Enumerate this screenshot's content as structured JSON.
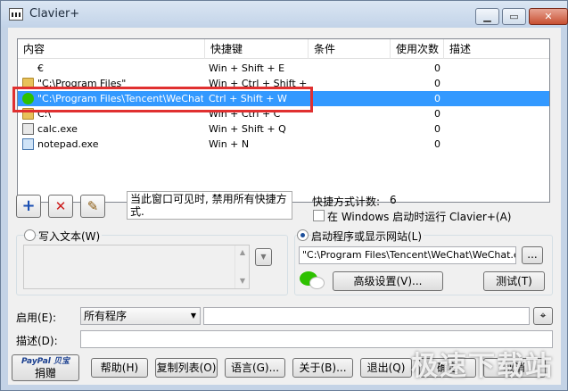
{
  "window": {
    "title": "Clavier+",
    "controls": {
      "minimize": "▁",
      "maximize": "▭",
      "close": "✕"
    }
  },
  "list": {
    "columns": [
      "内容",
      "快捷键",
      "条件",
      "使用次数",
      "描述"
    ],
    "rows": [
      {
        "content": "€",
        "hotkey": "Win + Shift + E",
        "condition": "",
        "uses": "0",
        "description": "",
        "icon": "blank-icon"
      },
      {
        "content": "\"C:\\Program Files\"",
        "hotkey": "Win + Ctrl + Shift + P",
        "condition": "",
        "uses": "0",
        "description": "",
        "icon": "folder-icon"
      },
      {
        "content": "\"C:\\Program Files\\Tencent\\WeChat\\...",
        "hotkey": "Ctrl + Shift + W",
        "condition": "",
        "uses": "0",
        "description": "",
        "icon": "wechat-icon",
        "selected": true
      },
      {
        "content": "C:\\",
        "hotkey": "Win + Ctrl + C",
        "condition": "",
        "uses": "0",
        "description": "",
        "icon": "folder-icon"
      },
      {
        "content": "calc.exe",
        "hotkey": "Win + Shift + Q",
        "condition": "",
        "uses": "0",
        "description": "",
        "icon": "calculator-icon"
      },
      {
        "content": "notepad.exe",
        "hotkey": "Win + N",
        "condition": "",
        "uses": "0",
        "description": "",
        "icon": "notepad-icon"
      }
    ]
  },
  "toolbar": {
    "add": "+",
    "delete": "✕",
    "edit": "✎"
  },
  "note_text": "当此窗口可见时, 禁用所有快捷方式.",
  "shortcut_count_label": "快捷方式计数:",
  "shortcut_count": "6",
  "run_on_startup_label": "在 Windows 启动时运行 Clavier+(A)",
  "write_text_label": "写入文本(W)",
  "launch_label": "启动程序或显示网站(L)",
  "launch_path": "\"C:\\Program Files\\Tencent\\WeChat\\WeChat.exe\"",
  "browse_button": "...",
  "advanced_button": "高级设置(V)...",
  "test_button": "测试(T)",
  "enable_label": "启用(E):",
  "enable_select": "所有程序",
  "description_label": "描述(D):",
  "description_value": "",
  "bottom_buttons": {
    "paypal_line1": "PayPal 贝宝",
    "paypal_line2": "捐赠",
    "help": "帮助(H)",
    "copy_list": "复制列表(O)",
    "language": "语言(G)...",
    "about": "关于(B)...",
    "exit": "退出(Q)",
    "ok": "确定",
    "cancel": "取消"
  },
  "watermark": "极速下载站"
}
